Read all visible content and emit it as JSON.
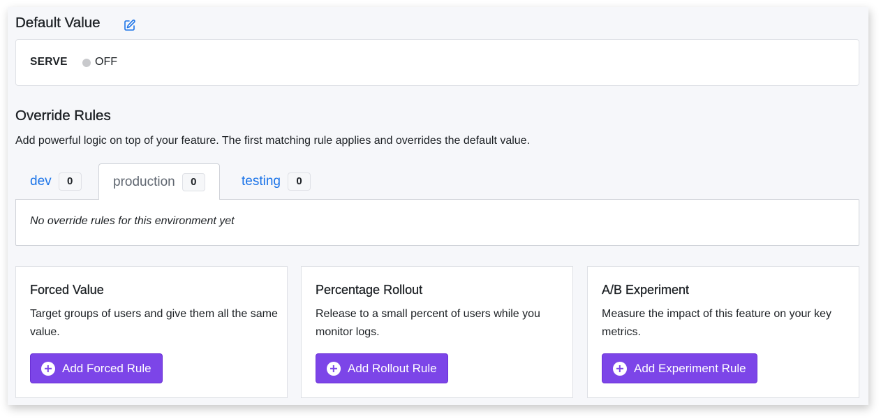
{
  "default_value": {
    "title": "Default Value",
    "edit_icon": "pencil-square-icon",
    "serve_label": "SERVE",
    "serve_value": "OFF",
    "status_dot_color": "#c8c9cc"
  },
  "override_rules": {
    "title": "Override Rules",
    "description": "Add powerful logic on top of your feature. The first matching rule applies and overrides the default value.",
    "tabs": [
      {
        "label": "dev",
        "count": "0",
        "active": false
      },
      {
        "label": "production",
        "count": "0",
        "active": true
      },
      {
        "label": "testing",
        "count": "0",
        "active": false
      }
    ],
    "empty_message": "No override rules for this environment yet"
  },
  "rule_types": [
    {
      "title": "Forced Value",
      "description": "Target groups of users and give them all the same value.",
      "button_label": "Add Forced Rule",
      "button_icon": "plus-circle-icon"
    },
    {
      "title": "Percentage Rollout",
      "description": "Release to a small percent of users while you monitor logs.",
      "button_label": "Add Rollout Rule",
      "button_icon": "plus-circle-icon"
    },
    {
      "title": "A/B Experiment",
      "description": "Measure the impact of this feature on your key metrics.",
      "button_label": "Add Experiment Rule",
      "button_icon": "plus-circle-icon"
    }
  ],
  "colors": {
    "link_blue": "#1a73e8",
    "primary_purple": "#7c45e8",
    "background": "#f6f7fa"
  }
}
